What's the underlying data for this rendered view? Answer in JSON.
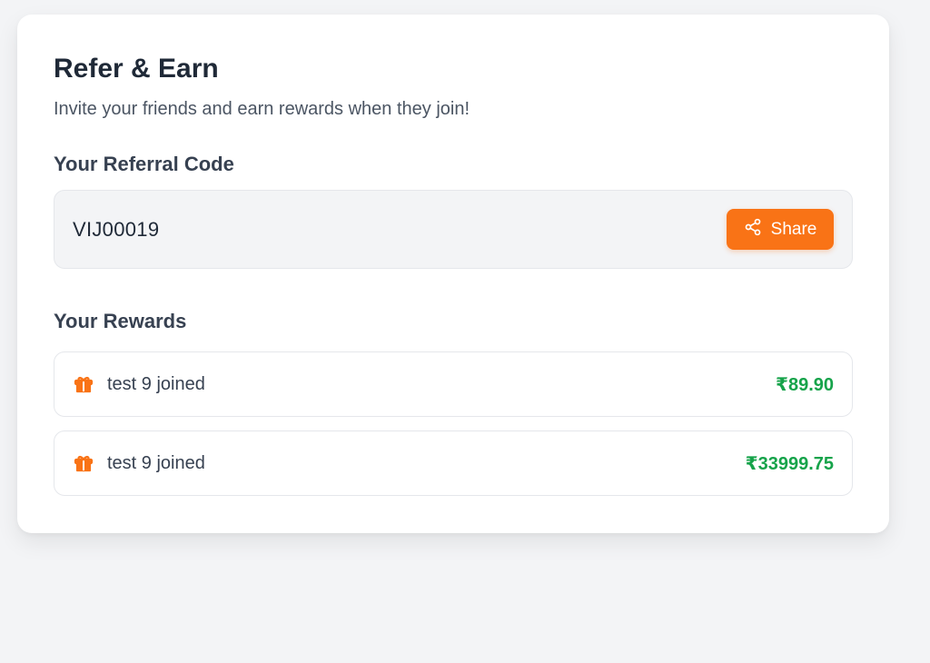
{
  "header": {
    "title": "Refer & Earn",
    "subtitle": "Invite your friends and earn rewards when they join!"
  },
  "referral": {
    "label": "Your Referral Code",
    "code": "VIJ00019",
    "share_label": "Share",
    "share_icon": "share-icon"
  },
  "rewards": {
    "label": "Your Rewards",
    "items": [
      {
        "icon": "gift-icon",
        "text": "test 9 joined",
        "amount": "₹89.90"
      },
      {
        "icon": "gift-icon",
        "text": "test 9 joined",
        "amount": "₹33999.75"
      }
    ]
  },
  "colors": {
    "accent": "#f97316",
    "amount": "#16a34a"
  }
}
